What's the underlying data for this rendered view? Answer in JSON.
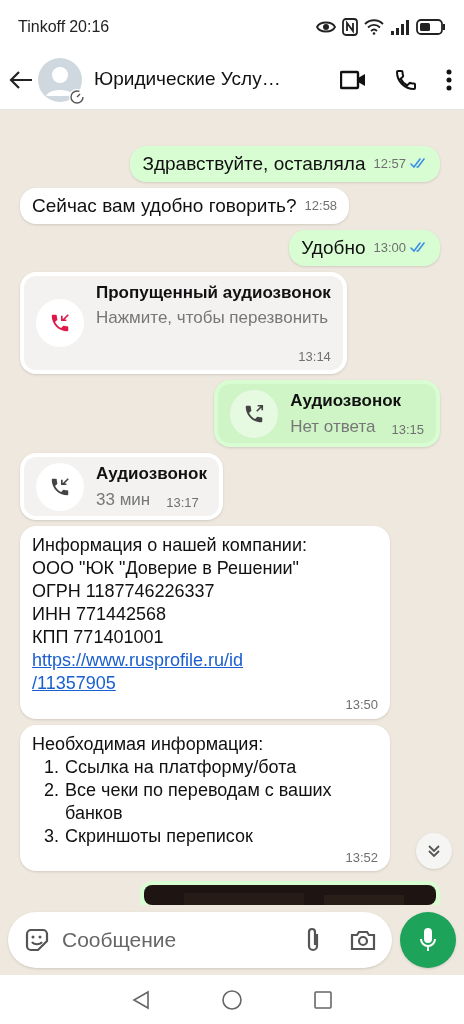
{
  "status_bar": {
    "carrier": "Tinkoff",
    "time": "20:16"
  },
  "header": {
    "title": "Юридические Услу…"
  },
  "messages": [
    {
      "kind": "text",
      "outgoing": true,
      "text": "Здравствуйте, оставляла",
      "time": "12:57",
      "read": true
    },
    {
      "kind": "text",
      "outgoing": false,
      "text": "Сейчас вам удобно говорить?",
      "time": "12:58"
    },
    {
      "kind": "text",
      "outgoing": true,
      "text": "Удобно",
      "time": "13:00",
      "read": true
    },
    {
      "kind": "call",
      "outgoing": false,
      "missed": true,
      "title": "Пропущенный аудиозвонок",
      "subtitle": "Нажмите, чтобы перезвонить",
      "time": "13:14"
    },
    {
      "kind": "call",
      "outgoing": true,
      "missed": false,
      "title": "Аудиозвонок",
      "subtitle": "Нет ответа",
      "time": "13:15"
    },
    {
      "kind": "call",
      "outgoing": false,
      "missed": false,
      "title": "Аудиозвонок",
      "subtitle": "33 мин",
      "time": "13:17"
    },
    {
      "kind": "lines",
      "outgoing": false,
      "lines": [
        {
          "text": "Информация о нашей компании:",
          "link": false
        },
        {
          "text": "ООО \"ЮК \"Доверие в Решении\"",
          "link": false
        },
        {
          "text": "ОГРН 1187746226337",
          "link": false
        },
        {
          "text": "ИНН 771442568",
          "link": false
        },
        {
          "text": "КПП 771401001",
          "link": false
        },
        {
          "text": "https://www.rusprofile.ru/id",
          "link": true
        },
        {
          "text": "/11357905",
          "link": true
        }
      ],
      "time": "13:50"
    },
    {
      "kind": "list",
      "outgoing": false,
      "heading": "Необходимая информация:",
      "items": [
        {
          "number": "1.",
          "text": "Ссылка на платформу/бота"
        },
        {
          "number": "2.",
          "text": "Все чеки по переводам с ваших банков"
        },
        {
          "number": "3.",
          "text": "Скриншоты переписок"
        }
      ],
      "time": "13:52"
    },
    {
      "kind": "picture",
      "outgoing": true
    }
  ],
  "composer": {
    "placeholder": "Сообщение"
  }
}
